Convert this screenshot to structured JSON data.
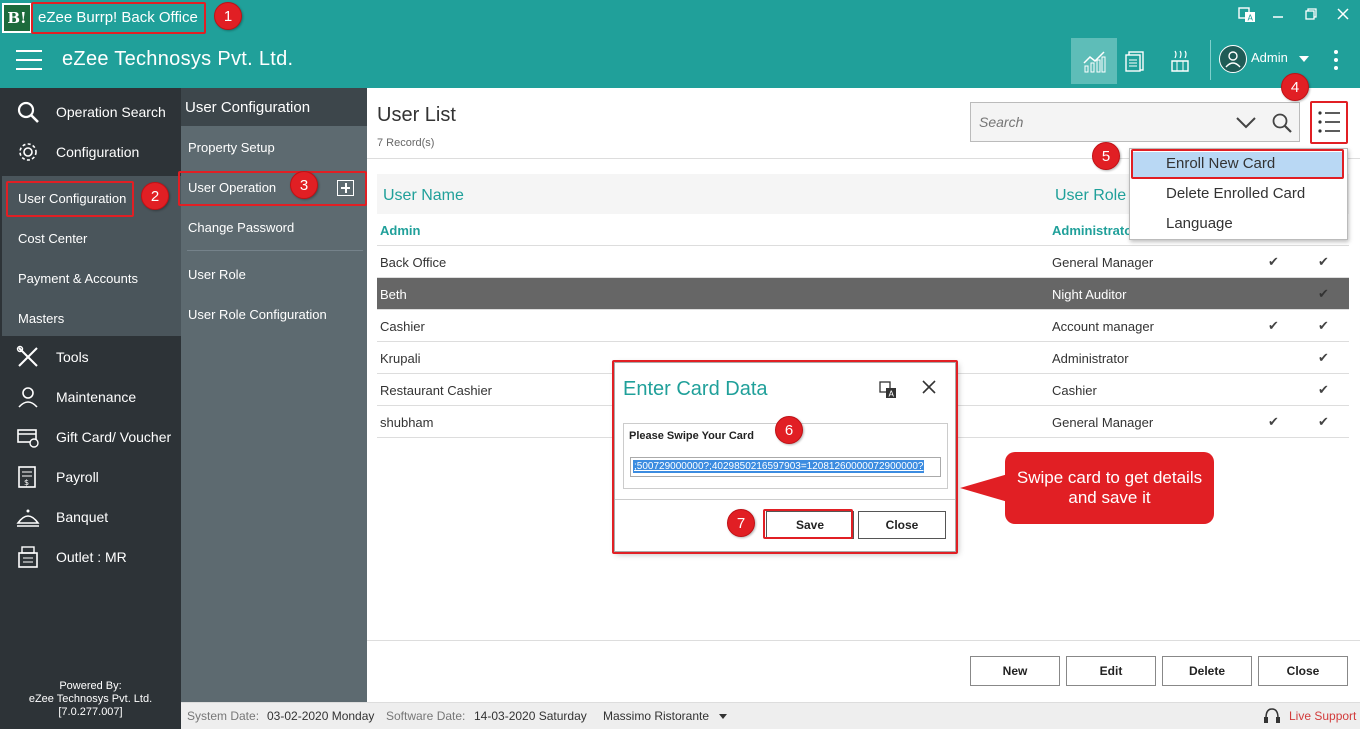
{
  "window": {
    "logo_text": "B!",
    "title": "eZee Burrp! Back Office"
  },
  "header": {
    "company": "eZee Technosys Pvt. Ltd.",
    "user": "Admin"
  },
  "sidebar": {
    "items": [
      {
        "label": "Operation Search",
        "icon": "search-icon"
      },
      {
        "label": "Configuration",
        "icon": "gear-icon"
      }
    ],
    "config_sub": [
      "User Configuration",
      "Cost Center",
      "Payment & Accounts",
      "Masters"
    ],
    "lower_items": [
      {
        "label": "Tools",
        "icon": "tools-icon"
      },
      {
        "label": "Maintenance",
        "icon": "maintenance-icon"
      },
      {
        "label": "Gift Card/ Voucher",
        "icon": "gift-card-icon"
      },
      {
        "label": "Payroll",
        "icon": "payroll-icon"
      },
      {
        "label": "Banquet",
        "icon": "banquet-icon"
      },
      {
        "label": "Outlet : MR",
        "icon": "outlet-icon"
      }
    ],
    "powered_by": "Powered By:",
    "powered_company": "eZee Technosys Pvt. Ltd.",
    "version": "[7.0.277.007]"
  },
  "subnav": {
    "heading": "User Configuration",
    "items": [
      "Property Setup",
      "User Operation",
      "Change Password",
      "User Role",
      "User Role Configuration"
    ]
  },
  "main": {
    "title": "User List",
    "record_count": "7 Record(s)",
    "search_placeholder": "Search",
    "columns": [
      "User Name",
      "User Role"
    ],
    "rows": [
      {
        "name": "Admin",
        "role": "Administrator",
        "check1": false,
        "check2": false,
        "header_style": true
      },
      {
        "name": "Back Office",
        "role": "General Manager",
        "check1": true,
        "check2": true
      },
      {
        "name": "Beth",
        "role": "Night Auditor",
        "check1": false,
        "check2": true,
        "selected": true
      },
      {
        "name": "Cashier",
        "role": "Account manager",
        "check1": true,
        "check2": true
      },
      {
        "name": "Krupali",
        "role": "Administrator",
        "check1": false,
        "check2": true
      },
      {
        "name": "Restaurant Cashier",
        "role": "Cashier",
        "check1": false,
        "check2": true
      },
      {
        "name": "shubham",
        "role": "General Manager",
        "check1": true,
        "check2": true
      }
    ],
    "buttons": {
      "new": "New",
      "edit": "Edit",
      "delete": "Delete",
      "close": "Close"
    }
  },
  "menu": {
    "items": [
      "Enroll New Card",
      "Delete Enrolled Card",
      "Language"
    ],
    "highlighted": "Enroll New Card"
  },
  "dialog": {
    "title": "Enter Card Data",
    "label": "Please Swipe Your Card",
    "value": ";500729000000?;4029850216597903=12081260000072900000?",
    "save": "Save",
    "close": "Close"
  },
  "status": {
    "system_date_label": "System Date:",
    "system_date": "03-02-2020 Monday",
    "software_date_label": "Software Date:",
    "software_date": "14-03-2020 Saturday",
    "property": "Massimo Ristorante",
    "live_support": "Live Support"
  },
  "annotations": {
    "badges": [
      "1",
      "2",
      "3",
      "4",
      "5",
      "6",
      "7"
    ],
    "callout": "Swipe card to get details and save it"
  },
  "colors": {
    "teal": "#20a09a",
    "dark": "#2d3337",
    "accent_red": "#e11f24"
  }
}
